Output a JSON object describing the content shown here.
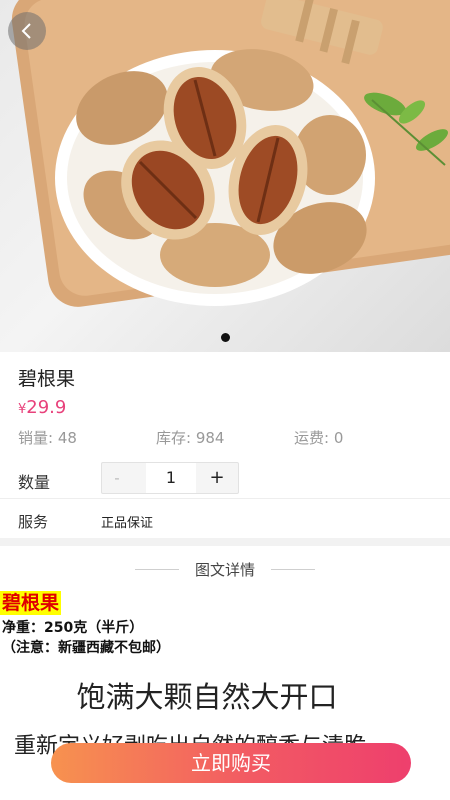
{
  "icons": {
    "back": "chevron-left-icon"
  },
  "hero": {
    "carousel_count": 1,
    "carousel_active": 1
  },
  "product": {
    "name": "碧根果",
    "price_symbol": "¥",
    "price": "29.9",
    "sales": "销量: 48",
    "stock": "库存: 984",
    "shipping": "运费: 0"
  },
  "quantity": {
    "label": "数量",
    "minus": "-",
    "value": "1",
    "plus": "+"
  },
  "service": {
    "label": "服务",
    "value": "正品保证"
  },
  "detail": {
    "header": "图文详情",
    "title": "碧根果",
    "weight": "净重：250克（半斤）",
    "note": "（注意：新疆西藏不包邮）",
    "headline": "饱满大颗自然大开口",
    "subline": "重新定义好剥吃出自然的醇香与清脆"
  },
  "buy_button": "立即购买",
  "colors": {
    "price": "#e8417b",
    "buy_start": "#f7924f",
    "buy_end": "#ee3f6d",
    "highlight_bg": "#ffff00",
    "highlight_text": "#e00000"
  }
}
